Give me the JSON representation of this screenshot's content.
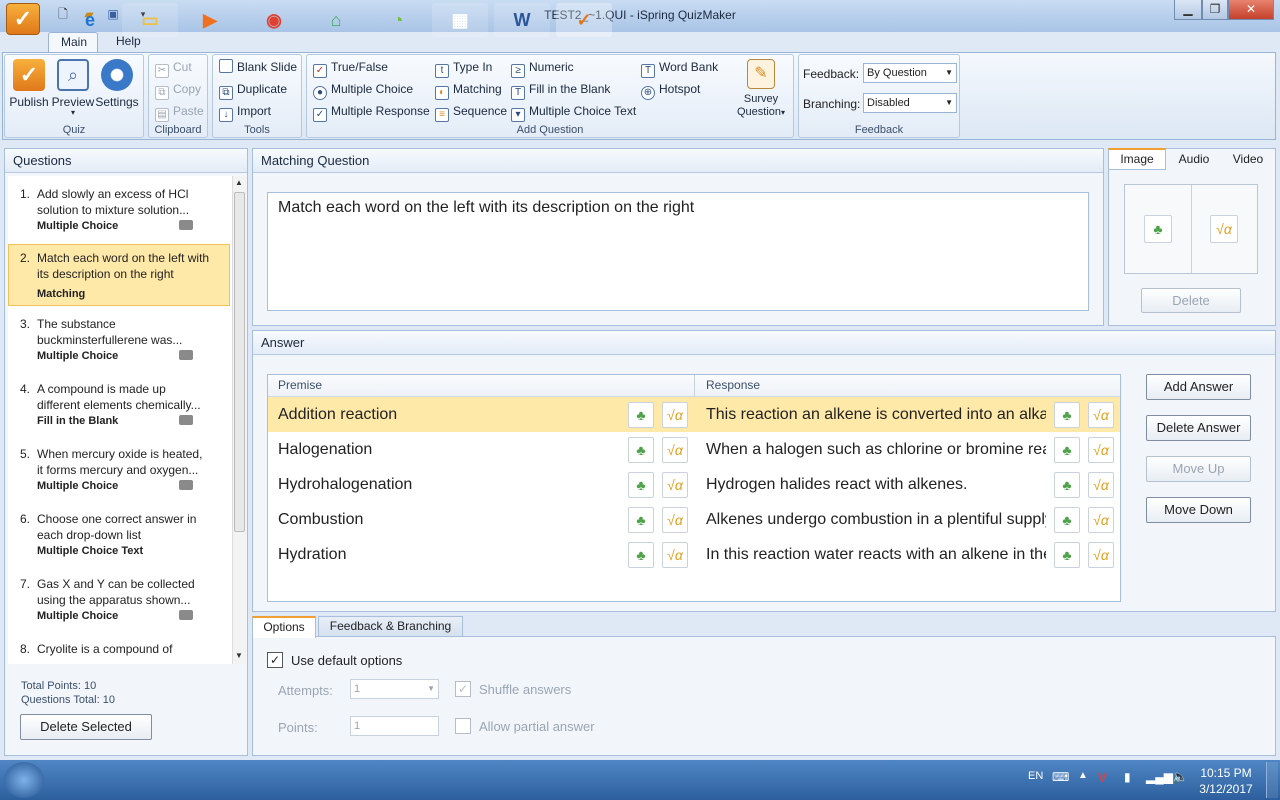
{
  "window": {
    "title": "TEST2_~1.QUI - iSpring QuizMaker"
  },
  "colors": {
    "accent": "#f0a030",
    "selection": "#ffe9a8",
    "ribbon": "#dce7f4"
  },
  "menu": {
    "tabs": [
      "Main",
      "Help"
    ]
  },
  "ribbon": {
    "quiz": {
      "label": "Quiz",
      "publish": "Publish",
      "preview": "Preview",
      "settings": "Settings"
    },
    "clipboard": {
      "label": "Clipboard",
      "cut": "Cut",
      "copy": "Copy",
      "paste": "Paste"
    },
    "tools": {
      "label": "Tools",
      "blank_slide": "Blank Slide",
      "duplicate": "Duplicate",
      "import": "Import"
    },
    "add_question": {
      "label": "Add Question",
      "true_false": "True/False",
      "multiple_choice": "Multiple Choice",
      "multiple_response": "Multiple Response",
      "type_in": "Type In",
      "matching": "Matching",
      "sequence": "Sequence",
      "numeric": "Numeric",
      "fill_blank": "Fill in the Blank",
      "mc_text": "Multiple Choice Text",
      "word_bank": "Word Bank",
      "hotspot": "Hotspot",
      "survey": "Survey",
      "survey2": "Question"
    },
    "feedback": {
      "label": "Feedback",
      "feedback_label": "Feedback:",
      "feedback_value": "By Question",
      "branching_label": "Branching:",
      "branching_value": "Disabled"
    }
  },
  "questions_panel": {
    "title": "Questions",
    "items": [
      {
        "num": "1.",
        "line1": "Add slowly an excess of HCl",
        "line2": "solution to mixture solution...",
        "type": "Multiple Choice"
      },
      {
        "num": "2.",
        "line1": "Match each word on the left with",
        "line2": "its description on the right",
        "type": "Matching"
      },
      {
        "num": "3.",
        "line1": "The substance",
        "line2": "buckminsterfullerene was...",
        "type": "Multiple Choice"
      },
      {
        "num": "4.",
        "line1": "A compound is made up",
        "line2": "different elements chemically...",
        "type": "Fill in the Blank"
      },
      {
        "num": "5.",
        "line1": "When mercury oxide is heated,",
        "line2": "it forms mercury and oxygen...",
        "type": "Multiple Choice"
      },
      {
        "num": "6.",
        "line1": "Choose one correct answer in",
        "line2": "each drop-down list",
        "type": "Multiple Choice Text"
      },
      {
        "num": "7.",
        "line1": "Gas X and Y can be collected",
        "line2": "using the apparatus shown...",
        "type": "Multiple Choice"
      },
      {
        "num": "8.",
        "line1": "Cryolite is a compound of",
        "line2": "",
        "type": ""
      }
    ],
    "total_points": "Total Points: 10",
    "questions_total": "Questions Total: 10",
    "delete_selected": "Delete Selected"
  },
  "question": {
    "header": "Matching Question",
    "text": "Match each word on the left with its description on the right"
  },
  "media": {
    "tabs": [
      "Image",
      "Audio",
      "Video"
    ],
    "delete": "Delete"
  },
  "answer": {
    "header": "Answer",
    "col_premise": "Premise",
    "col_response": "Response",
    "rows": [
      {
        "premise": "Addition reaction",
        "response": "This reaction an alkene is converted into an alka"
      },
      {
        "premise": "Halogenation",
        "response": "When a halogen such as chlorine or bromine rea"
      },
      {
        "premise": "Hydrohalogenation",
        "response": "Hydrogen halides react with alkenes."
      },
      {
        "premise": "Combustion",
        "response": "Alkenes undergo combustion in a plentiful supply"
      },
      {
        "premise": "Hydration",
        "response": "In this reaction water reacts with an alkene in the"
      }
    ],
    "add": "Add Answer",
    "delete": "Delete Answer",
    "move_up": "Move Up",
    "move_down": "Move Down"
  },
  "options": {
    "tabs": [
      "Options",
      "Feedback & Branching"
    ],
    "use_default": "Use default options",
    "attempts_label": "Attempts:",
    "attempts_value": "1",
    "shuffle": "Shuffle answers",
    "points_label": "Points:",
    "points_value": "1",
    "partial": "Allow partial answer"
  },
  "taskbar": {
    "lang": "EN",
    "time": "10:15 PM",
    "date": "3/12/2017"
  }
}
